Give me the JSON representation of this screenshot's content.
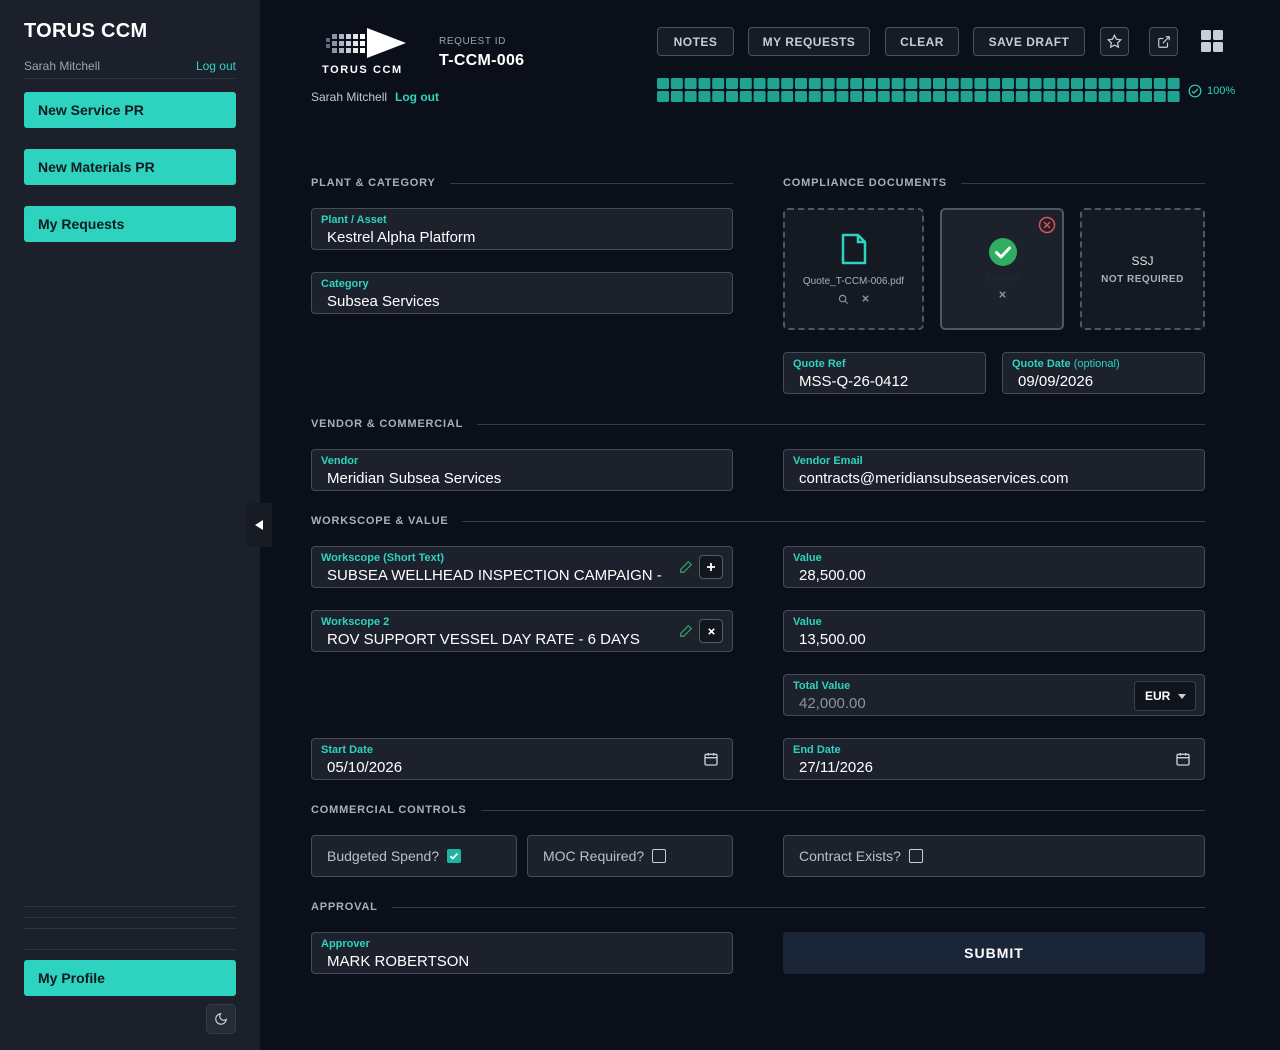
{
  "sidebar": {
    "app_title": "TORUS CCM",
    "user": "Sarah Mitchell",
    "logout": "Log out",
    "nav": [
      "New Service PR",
      "New Materials PR",
      "My Requests"
    ],
    "profile": "My Profile"
  },
  "header": {
    "logo_text": "TORUS CCM",
    "user": "Sarah Mitchell",
    "logout": "Log out",
    "request_id_label": "REQUEST ID",
    "request_id": "T-CCM-006",
    "buttons": [
      "NOTES",
      "MY REQUESTS",
      "CLEAR",
      "SAVE DRAFT"
    ],
    "icons": [
      "star-icon",
      "external-link-icon",
      "grid-icon"
    ],
    "progress": {
      "percent": 100,
      "label": "100%"
    }
  },
  "sections": {
    "plant_category": "PLANT & CATEGORY",
    "compliance": "COMPLIANCE DOCUMENTS",
    "vendor": "VENDOR & COMMERCIAL",
    "workscope": "WORKSCOPE & VALUE",
    "controls": "COMMERCIAL CONTROLS",
    "approval": "APPROVAL"
  },
  "fields": {
    "plant": {
      "label": "Plant / Asset",
      "value": "Kestrel Alpha Platform"
    },
    "category": {
      "label": "Category",
      "value": "Subsea Services"
    },
    "quote_ref": {
      "label": "Quote Ref",
      "value": "MSS-Q-26-0412"
    },
    "quote_date": {
      "label": "Quote Date",
      "optional": "(optional)",
      "value": "09/09/2026"
    },
    "vendor": {
      "label": "Vendor",
      "value": "Meridian Subsea Services"
    },
    "vendor_email": {
      "label": "Vendor Email",
      "value": "contracts@meridiansubseaservices.com"
    },
    "workscope1": {
      "label": "Workscope (Short Text)",
      "value": "SUBSEA WELLHEAD INSPECTION CAMPAIGN - PHA"
    },
    "workscope2": {
      "label": "Workscope 2",
      "value": "ROV SUPPORT VESSEL DAY RATE - 6 DAYS"
    },
    "value1": {
      "label": "Value",
      "value": "28,500.00"
    },
    "value2": {
      "label": "Value",
      "value": "13,500.00"
    },
    "total": {
      "label": "Total Value",
      "value": "42,000.00",
      "currency": "EUR"
    },
    "start_date": {
      "label": "Start Date",
      "value": "05/10/2026"
    },
    "end_date": {
      "label": "End Date",
      "value": "27/11/2026"
    },
    "approver": {
      "label": "Approver",
      "value": "MARK ROBERTSON"
    }
  },
  "documents": {
    "quote_file": "Quote_T-CCM-006.pdf",
    "service_label": "Service",
    "ssj_title": "SSJ",
    "ssj_status": "NOT REQUIRED"
  },
  "controls": {
    "budgeted": {
      "label": "Budgeted Spend?",
      "checked": true
    },
    "moc": {
      "label": "MOC Required?",
      "checked": false
    },
    "contract": {
      "label": "Contract Exists?",
      "checked": false
    }
  },
  "submit": "SUBMIT",
  "colors": {
    "accent": "#2ed3bf",
    "background": "#0a0f1a",
    "sidebar": "#1b202a",
    "success": "#2fae61",
    "danger": "#e05252"
  }
}
